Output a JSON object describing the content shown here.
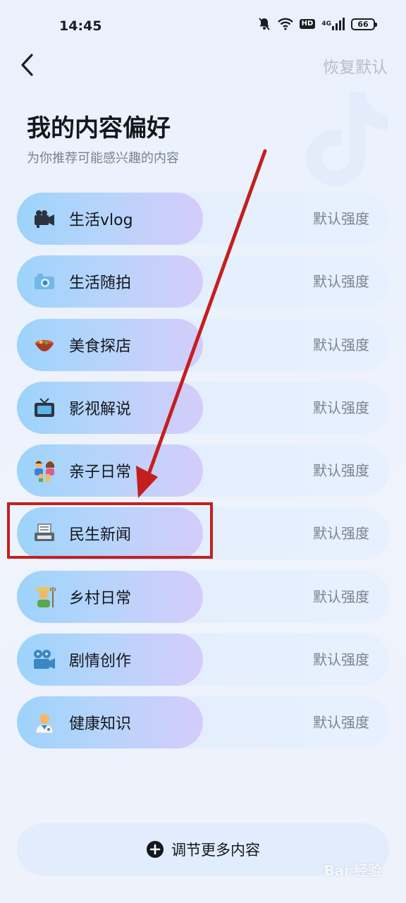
{
  "status_bar": {
    "time": "14:45",
    "hd_label": "HD",
    "network_label": "4G",
    "battery_level": "66"
  },
  "header": {
    "reset_label": "恢复默认"
  },
  "page": {
    "title": "我的内容偏好",
    "subtitle": "为你推荐可能感兴趣的内容"
  },
  "preferences": [
    {
      "label": "生活vlog",
      "strength": "默认强度",
      "icon": "video-camera-icon"
    },
    {
      "label": "生活随拍",
      "strength": "默认强度",
      "icon": "camera-icon"
    },
    {
      "label": "美食探店",
      "strength": "默认强度",
      "icon": "food-bowl-icon"
    },
    {
      "label": "影视解说",
      "strength": "默认强度",
      "icon": "tv-icon"
    },
    {
      "label": "亲子日常",
      "strength": "默认强度",
      "icon": "family-icon"
    },
    {
      "label": "民生新闻",
      "strength": "默认强度",
      "icon": "newspaper-icon"
    },
    {
      "label": "乡村日常",
      "strength": "默认强度",
      "icon": "farmer-icon"
    },
    {
      "label": "剧情创作",
      "strength": "默认强度",
      "icon": "film-camera-icon"
    },
    {
      "label": "健康知识",
      "strength": "默认强度",
      "icon": "doctor-icon"
    }
  ],
  "footer": {
    "more_label": "调节更多内容"
  },
  "watermark": {
    "text": "Bai 经验"
  },
  "colors": {
    "annotation_red": "#c41f1f",
    "pill_start": "#9dd3fb",
    "pill_end": "#d4ccfb"
  }
}
